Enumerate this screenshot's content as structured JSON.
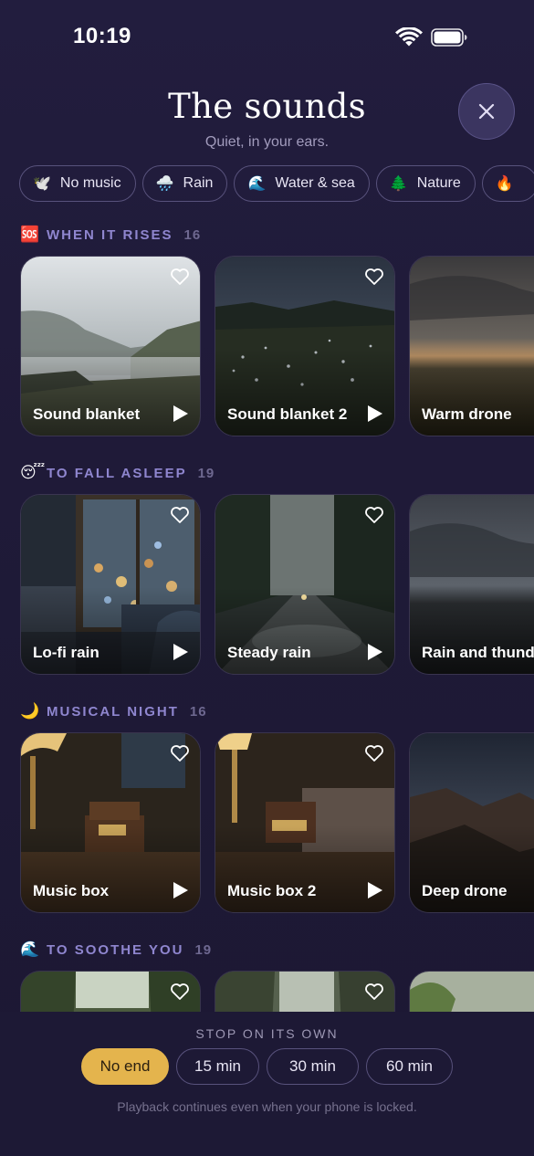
{
  "status": {
    "time": "10:19"
  },
  "header": {
    "title": "The sounds",
    "subtitle": "Quiet, in your ears."
  },
  "chips": [
    {
      "emoji": "🕊️",
      "label": "No music"
    },
    {
      "emoji": "🌧️",
      "label": "Rain"
    },
    {
      "emoji": "🌊",
      "label": "Water & sea"
    },
    {
      "emoji": "🌲",
      "label": "Nature"
    },
    {
      "emoji": "🔥",
      "label": ""
    }
  ],
  "sections": [
    {
      "emoji": "🆘",
      "title": "WHEN IT RISES",
      "count": "16",
      "cards": [
        {
          "label": "Sound blanket"
        },
        {
          "label": "Sound blanket 2"
        },
        {
          "label": "Warm drone"
        }
      ]
    },
    {
      "emoji": "😴",
      "title": "TO FALL ASLEEP",
      "count": "19",
      "cards": [
        {
          "label": "Lo-fi rain"
        },
        {
          "label": "Steady rain"
        },
        {
          "label": "Rain and thunder"
        }
      ]
    },
    {
      "emoji": "🌙",
      "title": "MUSICAL NIGHT",
      "count": "16",
      "cards": [
        {
          "label": "Music box"
        },
        {
          "label": "Music box 2"
        },
        {
          "label": "Deep drone"
        }
      ]
    },
    {
      "emoji": "🌊",
      "title": "TO SOOTHE YOU",
      "count": "19",
      "cards": [
        {
          "label": ""
        },
        {
          "label": ""
        },
        {
          "label": ""
        }
      ]
    }
  ],
  "stop": {
    "title": "STOP ON ITS OWN",
    "options": [
      "No end",
      "15 min",
      "30 min",
      "60 min"
    ],
    "selected": "No end",
    "note": "Playback continues even when your phone is locked."
  },
  "colors": {
    "accent": "#8f86cf",
    "timer_active": "#e4b44d",
    "background": "#221d3e"
  }
}
